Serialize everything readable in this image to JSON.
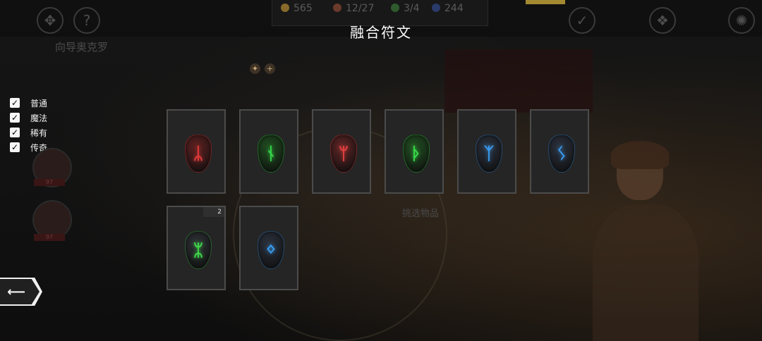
{
  "header": {
    "title": "融合符文",
    "npc_name": "向导奥克罗",
    "resources": [
      {
        "icon": "coin-icon",
        "value": "565",
        "color": "#8a6a2a"
      },
      {
        "icon": "bag-icon",
        "value": "12/27",
        "color": "#6a3a2a"
      },
      {
        "icon": "clover-icon",
        "value": "3/4",
        "color": "#2e5a2e"
      },
      {
        "icon": "gem-icon",
        "value": "244",
        "color": "#2a3a6a"
      }
    ]
  },
  "top_icons": [
    {
      "name": "trinity-knot-icon",
      "glyph": "✥"
    },
    {
      "name": "help-icon",
      "glyph": "?"
    },
    {
      "name": "checkmark-icon",
      "glyph": "✓"
    },
    {
      "name": "map-icon",
      "glyph": "❖"
    },
    {
      "name": "compass-icon",
      "glyph": "✺"
    }
  ],
  "filters": [
    {
      "label": "普通",
      "checked": true
    },
    {
      "label": "魔法",
      "checked": true
    },
    {
      "label": "稀有",
      "checked": true
    },
    {
      "label": "传奇",
      "checked": true
    }
  ],
  "party": [
    {
      "level": "97"
    },
    {
      "level": "97"
    }
  ],
  "hint": "挑选物品",
  "runes": [
    {
      "name": "rune-red-1",
      "color": "#e33a3a",
      "stone": "#5a2020",
      "glyph": "ᛦ",
      "count": ""
    },
    {
      "name": "rune-green-1",
      "color": "#37d84a",
      "stone": "#1f4a1f",
      "glyph": "ᚾ",
      "count": ""
    },
    {
      "name": "rune-red-2",
      "color": "#e44040",
      "stone": "#5a2424",
      "glyph": "ᛘ",
      "count": ""
    },
    {
      "name": "rune-green-2",
      "color": "#38dc48",
      "stone": "#214d21",
      "glyph": "ᚦ",
      "count": ""
    },
    {
      "name": "rune-blue-1",
      "color": "#3a9cf0",
      "stone": "#2a2f3a",
      "glyph": "ᛉ",
      "count": ""
    },
    {
      "name": "rune-blue-2",
      "color": "#3a9cf0",
      "stone": "#2a2f3a",
      "glyph": "ᛊ",
      "count": ""
    },
    {
      "name": "rune-green-3",
      "color": "#3fd84a",
      "stone": "#2c2f33",
      "glyph": "ᛯ",
      "count": "2"
    },
    {
      "name": "rune-blue-3",
      "color": "#3aa0f5",
      "stone": "#2a2f3a",
      "glyph": "ᛜ",
      "count": ""
    }
  ]
}
